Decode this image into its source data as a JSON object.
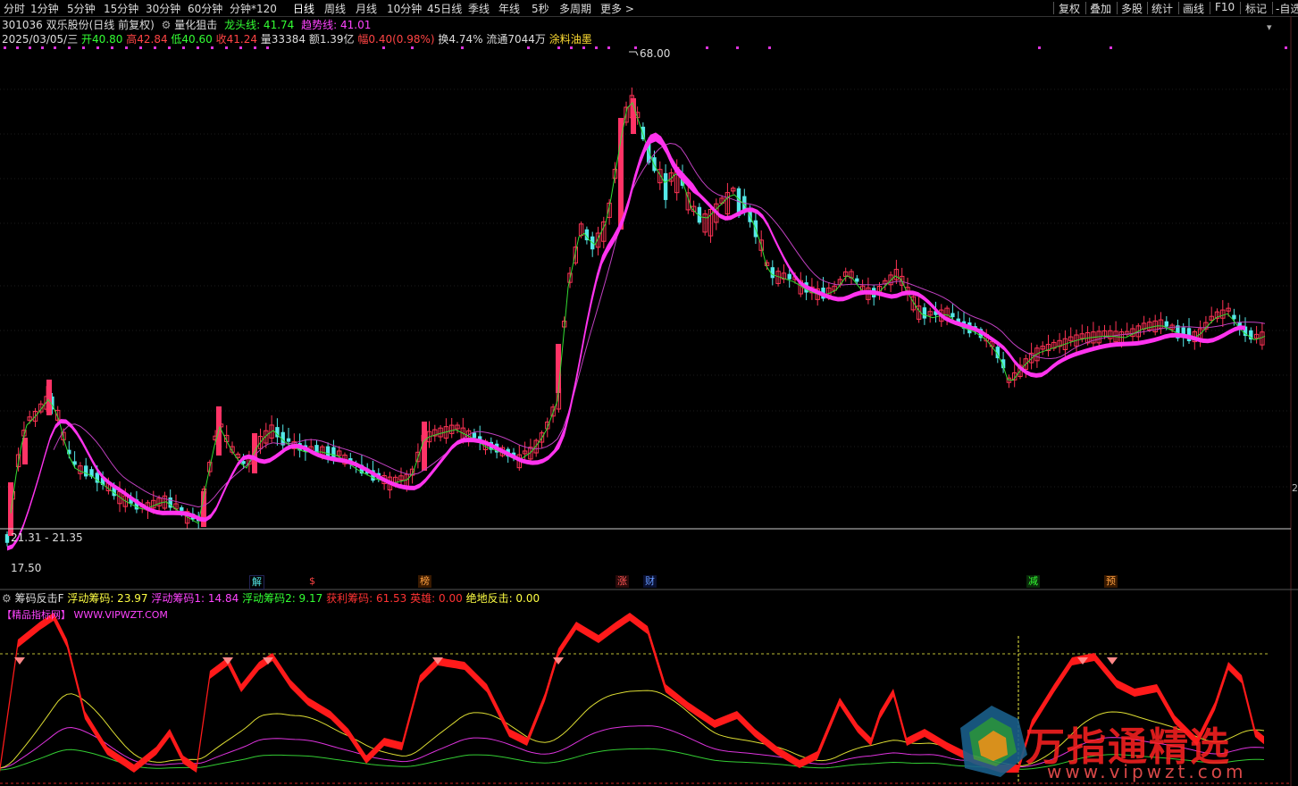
{
  "toolbar": {
    "periods": [
      "分时",
      "1分钟",
      "5分钟",
      "15分钟",
      "30分钟",
      "60分钟",
      "分钟*120",
      "日线",
      "周线",
      "月线",
      "10分钟",
      "45日线",
      "季线",
      "年线",
      "5秒",
      "多周期",
      "更多 >"
    ],
    "right": [
      "复权",
      "叠加",
      "多股",
      "统计",
      "画线",
      "F10",
      "标记",
      "-自选"
    ]
  },
  "stock": {
    "header": "301036 双乐股份(日线 前复权)",
    "indicator_name": "量化狙击",
    "dragon_label": "龙头线: 41.74",
    "trend_label": "趋势线: 41.01",
    "date": "2025/03/05/三",
    "open": "开40.80",
    "high": "高42.84",
    "low": "低40.60",
    "close": "收41.24",
    "volume": "量33384",
    "amount": "额1.39亿",
    "change": "幅0.40(0.98%)",
    "turnover": "换4.74%",
    "float": "流通7044万",
    "sector": "涂料油墨"
  },
  "main_chart": {
    "high_label": "68.00",
    "low_range_label": "21.31 - 21.35",
    "low_label": "17.50",
    "right_edge_label": "2",
    "colors": {
      "up": "#ff3355",
      "down": "#54e8e8",
      "trend": "#ff3cff",
      "ma": "#cc44cc",
      "dragon": "#33ff33"
    }
  },
  "events": [
    {
      "label": "解",
      "color": "#54e8e8"
    },
    {
      "label": "$",
      "color": "#ff4444"
    },
    {
      "label": "榜",
      "color": "#ffa040"
    },
    {
      "label": "涨",
      "color": "#ff5555"
    },
    {
      "label": "财",
      "color": "#6699ff"
    },
    {
      "label": "减",
      "color": "#33ff33"
    },
    {
      "label": "预",
      "color": "#ffa040"
    }
  ],
  "sub_chart": {
    "name": "筹码反击F",
    "v1": "浮动筹码: 23.97",
    "v2": "浮动筹码1: 14.84",
    "v3": "浮动筹码2: 9.17",
    "v4": "获利筹码: 61.53",
    "v5": "英雄: 0.00",
    "v6": "绝地反击: 0.00",
    "brand": "【精品指标网】",
    "url": "WWW.VIPWZT.COM"
  },
  "watermark": {
    "title": "万指通精选",
    "url": "www.vipwzt.com"
  }
}
